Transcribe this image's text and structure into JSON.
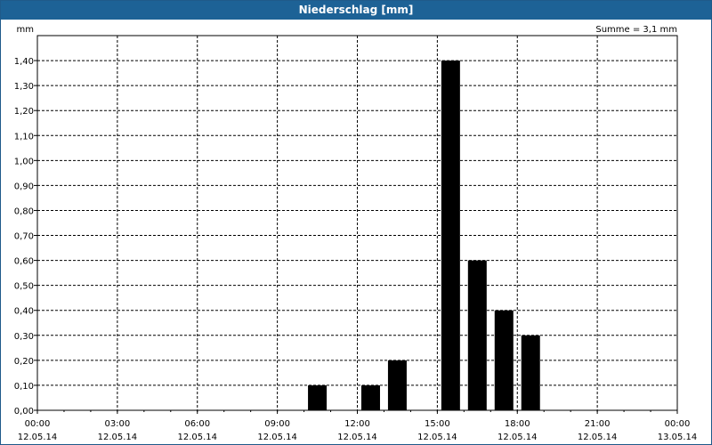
{
  "window": {
    "title": "Niederschlag [mm]"
  },
  "chart_data": {
    "type": "bar",
    "title": "Niederschlag [mm]",
    "ylabel": "mm",
    "annotation": "Summe = 3,1 mm",
    "ylim": [
      0,
      1.5
    ],
    "xlim": [
      "12.05.14 00:00",
      "13.05.14 00:00"
    ],
    "y_ticks": [
      "0,00",
      "0,10",
      "0,20",
      "0,30",
      "0,40",
      "0,50",
      "0,60",
      "0,70",
      "0,80",
      "0,90",
      "1,00",
      "1,10",
      "1,20",
      "1,30",
      "1,40"
    ],
    "x_ticks": [
      {
        "time": "00:00",
        "date": "12.05.14"
      },
      {
        "time": "03:00",
        "date": "12.05.14"
      },
      {
        "time": "06:00",
        "date": "12.05.14"
      },
      {
        "time": "09:00",
        "date": "12.05.14"
      },
      {
        "time": "12:00",
        "date": "12.05.14"
      },
      {
        "time": "15:00",
        "date": "12.05.14"
      },
      {
        "time": "18:00",
        "date": "12.05.14"
      },
      {
        "time": "21:00",
        "date": "12.05.14"
      },
      {
        "time": "00:00",
        "date": "13.05.14"
      }
    ],
    "bars": [
      {
        "hour": 10,
        "value": 0.1
      },
      {
        "hour": 12,
        "value": 0.1
      },
      {
        "hour": 13,
        "value": 0.2
      },
      {
        "hour": 15,
        "value": 1.4
      },
      {
        "hour": 16,
        "value": 0.6
      },
      {
        "hour": 17,
        "value": 0.4
      },
      {
        "hour": 18,
        "value": 0.3
      }
    ],
    "grid": true,
    "colors": {
      "bar": "#000000",
      "title_bar": "#1d6296"
    }
  }
}
